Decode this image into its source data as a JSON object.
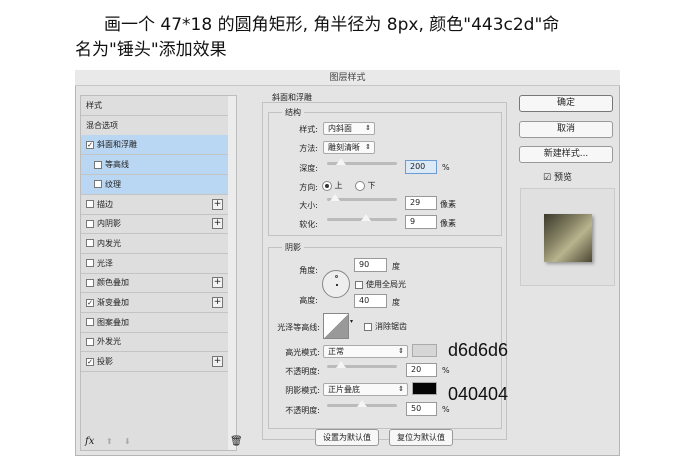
{
  "intro": {
    "line1": "画一个 47*18 的圆角矩形, 角半径为 8px, 颜色\"443c2d\"命",
    "line2": "名为\"锤头\"添加效果"
  },
  "dialog": {
    "title": "图层样式"
  },
  "styles_list": {
    "items": [
      {
        "label": "样式",
        "check": null,
        "plus": false,
        "selected": false,
        "indent": false
      },
      {
        "label": "混合选项",
        "check": null,
        "plus": false,
        "selected": false,
        "indent": false
      },
      {
        "label": "斜面和浮雕",
        "check": true,
        "plus": false,
        "selected": true,
        "indent": false
      },
      {
        "label": "等高线",
        "check": false,
        "plus": false,
        "selected": true,
        "indent": true
      },
      {
        "label": "纹理",
        "check": false,
        "plus": false,
        "selected": true,
        "indent": true
      },
      {
        "label": "描边",
        "check": false,
        "plus": true,
        "selected": false,
        "indent": false
      },
      {
        "label": "内阴影",
        "check": false,
        "plus": true,
        "selected": false,
        "indent": false
      },
      {
        "label": "内发光",
        "check": false,
        "plus": false,
        "selected": false,
        "indent": false
      },
      {
        "label": "光泽",
        "check": false,
        "plus": false,
        "selected": false,
        "indent": false
      },
      {
        "label": "颜色叠加",
        "check": false,
        "plus": true,
        "selected": false,
        "indent": false
      },
      {
        "label": "渐变叠加",
        "check": true,
        "plus": true,
        "selected": false,
        "indent": false
      },
      {
        "label": "图案叠加",
        "check": false,
        "plus": false,
        "selected": false,
        "indent": false
      },
      {
        "label": "外发光",
        "check": false,
        "plus": false,
        "selected": false,
        "indent": false
      },
      {
        "label": "投影",
        "check": true,
        "plus": true,
        "selected": false,
        "indent": false
      }
    ]
  },
  "bevel": {
    "group": "斜面和浮雕",
    "structure": "结构",
    "style_label": "样式:",
    "style_value": "内斜面",
    "method_label": "方法:",
    "method_value": "雕刻清晰",
    "depth_label": "深度:",
    "depth_value": "200",
    "depth_unit": "%",
    "depth_slider": 0.2,
    "direction_label": "方向:",
    "dir_up": "上",
    "dir_down": "下",
    "size_label": "大小:",
    "size_value": "29",
    "size_unit": "像素",
    "size_slider": 0.12,
    "soften_label": "软化:",
    "soften_value": "9",
    "soften_unit": "像素",
    "soften_slider": 0.55
  },
  "shading": {
    "group": "阴影",
    "angle_label": "角度:",
    "angle_value": "90",
    "angle_unit": "度",
    "global_light": "使用全局光",
    "altitude_label": "高度:",
    "altitude_value": "40",
    "altitude_unit": "度",
    "gloss_label": "光泽等高线:",
    "anti_alias": "消除锯齿",
    "highlight_label": "高光模式:",
    "highlight_mode": "正常",
    "highlight_color": "#d6d6d6",
    "hl_opacity_label": "不透明度:",
    "hl_opacity": "20",
    "hl_opacity_unit": "%",
    "hl_slider": 0.2,
    "shadow_label": "阴影模式:",
    "shadow_mode": "正片叠底",
    "shadow_color": "#040404",
    "sh_opacity_label": "不透明度:",
    "sh_opacity": "50",
    "sh_opacity_unit": "%",
    "sh_slider": 0.5,
    "make_default": "设置为默认值",
    "reset_default": "复位为默认值"
  },
  "annotations": {
    "highlight": "d6d6d6",
    "shadow": "040404"
  },
  "buttons": {
    "ok": "确定",
    "cancel": "取消",
    "new_style": "新建样式...",
    "preview": "预览"
  },
  "footer": {
    "fx": "fx"
  }
}
